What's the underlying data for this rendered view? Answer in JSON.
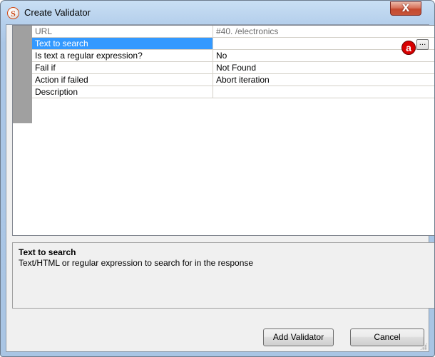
{
  "window": {
    "title": "Create Validator",
    "app_icon_letter": "S",
    "close_symbol": "X"
  },
  "grid": {
    "rows": [
      {
        "name": "URL",
        "value": "#40. /electronics",
        "state": "readonly"
      },
      {
        "name": "Text to search",
        "value": "",
        "state": "selected"
      },
      {
        "name": "Is text a regular expression?",
        "value": "No",
        "state": "normal"
      },
      {
        "name": "Fail if",
        "value": "Not Found",
        "state": "normal"
      },
      {
        "name": "Action if failed",
        "value": "Abort iteration",
        "state": "normal"
      },
      {
        "name": "Description",
        "value": "",
        "state": "normal"
      }
    ],
    "ellipsis_label": "...",
    "marker_label": "a"
  },
  "help": {
    "title": "Text to search",
    "description": "Text/HTML or regular expression to search for in the response"
  },
  "buttons": {
    "add_label": "Add Validator",
    "cancel_label": "Cancel"
  },
  "colors": {
    "selection": "#3399ff",
    "gutter": "#a0a0a0",
    "marker": "#d80000"
  }
}
